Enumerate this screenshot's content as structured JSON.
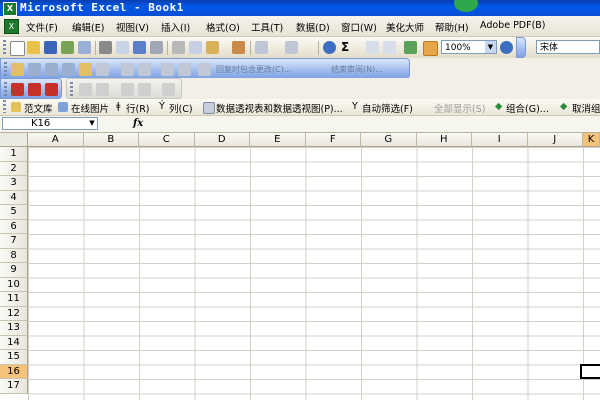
{
  "window": {
    "title": "Microsoft Excel - Book1"
  },
  "menu": {
    "items": [
      "文件(F)",
      "编辑(E)",
      "视图(V)",
      "插入(I)",
      "格式(O)",
      "工具(T)",
      "数据(D)",
      "窗口(W)",
      "美化大师",
      "帮助(H)",
      "Adobe PDF(B)"
    ]
  },
  "toolbar1": {
    "zoom": "100%",
    "font": "宋体"
  },
  "toolbar2": {
    "reply_label": "回复时包含更改(C)...",
    "end_review_label": "结束审阅(N)..."
  },
  "toolbar4": {
    "items": [
      "范文库",
      "在线图片",
      "行(R)",
      "列(C)",
      "数据透视表和数据透视图(P)...",
      "自动筛选(F)",
      "全部显示(S)",
      "组合(G)...",
      "取消组合"
    ]
  },
  "formula_bar": {
    "name_box": "K16",
    "fx": "fx"
  },
  "sheet": {
    "columns": [
      "A",
      "B",
      "C",
      "D",
      "E",
      "F",
      "G",
      "H",
      "I",
      "J",
      "K"
    ],
    "rows": [
      "1",
      "2",
      "3",
      "4",
      "5",
      "6",
      "7",
      "8",
      "9",
      "10",
      "11",
      "12",
      "13",
      "14",
      "15",
      "16",
      "17"
    ],
    "active_row": "16"
  }
}
